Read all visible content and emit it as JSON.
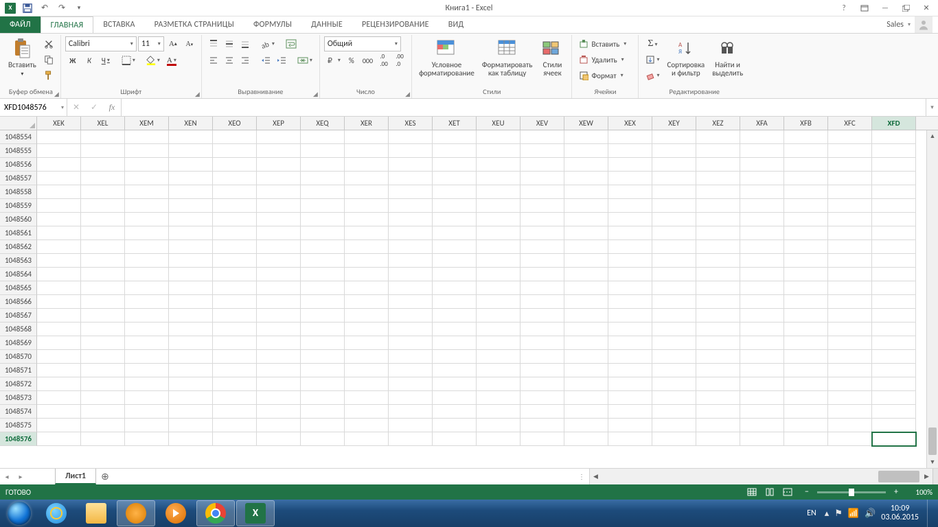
{
  "title": "Книга1 - Excel",
  "qat": {
    "undo_tip": "↶",
    "redo_tip": "↷"
  },
  "tabs": {
    "file": "ФАЙЛ",
    "items": [
      "ГЛАВНАЯ",
      "ВСТАВКА",
      "РАЗМЕТКА СТРАНИЦЫ",
      "ФОРМУЛЫ",
      "ДАННЫЕ",
      "РЕЦЕНЗИРОВАНИЕ",
      "ВИД"
    ],
    "active_index": 0,
    "account": "Sales"
  },
  "ribbon": {
    "clipboard": {
      "paste": "Вставить",
      "label": "Буфер обмена"
    },
    "font": {
      "name": "Calibri",
      "size": "11",
      "bold": "Ж",
      "italic": "К",
      "underline": "Ч",
      "label": "Шрифт"
    },
    "align": {
      "label": "Выравнивание",
      "wrap_tip": "Wrap",
      "merge_tip": "Merge"
    },
    "number": {
      "format": "Общий",
      "label": "Число"
    },
    "styles": {
      "cond": "Условное\nформатирование",
      "table": "Форматировать\nкак таблицу",
      "cell": "Стили\nячеек",
      "label": "Стили"
    },
    "cells": {
      "insert": "Вставить",
      "delete": "Удалить",
      "format": "Формат",
      "label": "Ячейки"
    },
    "editing": {
      "sort": "Сортировка\nи фильтр",
      "find": "Найти и\nвыделить",
      "label": "Редактирование"
    }
  },
  "namebox": "XFD1048576",
  "columns": [
    "XEK",
    "XEL",
    "XEM",
    "XEN",
    "XEO",
    "XEP",
    "XEQ",
    "XER",
    "XES",
    "XET",
    "XEU",
    "XEV",
    "XEW",
    "XEX",
    "XEY",
    "XEZ",
    "XFA",
    "XFB",
    "XFC",
    "XFD"
  ],
  "row_start": 1048554,
  "row_end": 1048576,
  "active": {
    "col": "XFD",
    "row": 1048576
  },
  "sheet": {
    "name": "Лист1"
  },
  "status": {
    "ready": "ГОТОВО",
    "zoom": "100%"
  },
  "tray": {
    "lang": "EN",
    "time": "10:09",
    "date": "03.06.2015"
  }
}
